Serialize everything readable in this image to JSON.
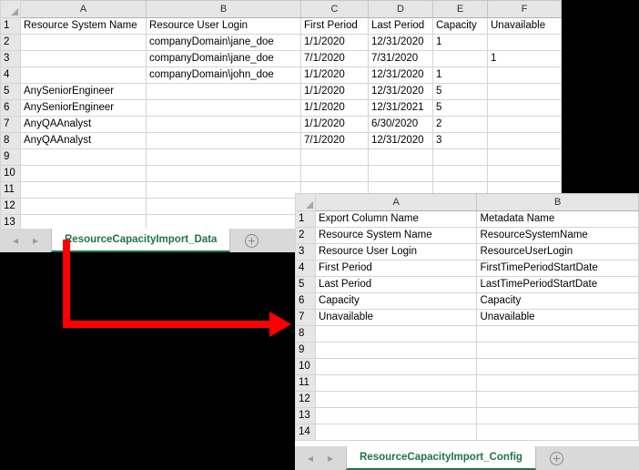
{
  "theme": {
    "accent_green": "#217346",
    "arrow_color": "#FF0000",
    "header_gray": "#E6E6E6",
    "grid_line": "#D4D4D4",
    "backdrop": "#000000"
  },
  "data_sheet": {
    "tab_label": "ResourceCapacityImport_Data",
    "nav_prev_icon": "left-arrow-icon",
    "nav_next_icon": "right-arrow-icon",
    "add_sheet_icon": "plus-circle-icon",
    "corner_icon": "select-all-triangle-icon",
    "column_letters": [
      "A",
      "B",
      "C",
      "D",
      "E",
      "F"
    ],
    "row_numbers": [
      "1",
      "2",
      "3",
      "4",
      "5",
      "6",
      "7",
      "8",
      "9",
      "10",
      "11",
      "12",
      "13",
      "14"
    ],
    "headers": [
      "Resource System Name",
      "Resource User Login",
      "First Period",
      "Last Period",
      "Capacity",
      "Unavailable"
    ],
    "rows": [
      [
        "",
        "companyDomain\\jane_doe",
        "1/1/2020",
        "12/31/2020",
        "1",
        ""
      ],
      [
        "",
        "companyDomain\\jane_doe",
        "7/1/2020",
        "7/31/2020",
        "",
        "1"
      ],
      [
        "",
        "companyDomain\\john_doe",
        "1/1/2020",
        "12/31/2020",
        "1",
        ""
      ],
      [
        "AnySeniorEngineer",
        "",
        "1/1/2020",
        "12/31/2020",
        "5",
        ""
      ],
      [
        "AnySeniorEngineer",
        "",
        "1/1/2020",
        "12/31/2021",
        "5",
        ""
      ],
      [
        "AnyQAAnalyst",
        "",
        "1/1/2020",
        "6/30/2020",
        "2",
        ""
      ],
      [
        "AnyQAAnalyst",
        "",
        "7/1/2020",
        "12/31/2020",
        "3",
        ""
      ],
      [
        "",
        "",
        "",
        "",
        "",
        ""
      ],
      [
        "",
        "",
        "",
        "",
        "",
        ""
      ],
      [
        "",
        "",
        "",
        "",
        "",
        ""
      ],
      [
        "",
        "",
        "",
        "",
        "",
        ""
      ],
      [
        "",
        "",
        "",
        "",
        "",
        ""
      ],
      [
        "",
        "",
        "",
        "",
        "",
        ""
      ]
    ]
  },
  "config_sheet": {
    "tab_label": "ResourceCapacityImport_Config",
    "nav_prev_icon": "left-arrow-icon",
    "nav_next_icon": "right-arrow-icon",
    "add_sheet_icon": "plus-circle-icon",
    "corner_icon": "select-all-triangle-icon",
    "column_letters": [
      "A",
      "B"
    ],
    "row_numbers": [
      "1",
      "2",
      "3",
      "4",
      "5",
      "6",
      "7",
      "8",
      "9",
      "10",
      "11",
      "12",
      "13",
      "14"
    ],
    "headers": [
      "Export Column Name",
      "Metadata Name"
    ],
    "rows": [
      [
        "Resource System Name",
        "ResourceSystemName"
      ],
      [
        "Resource User Login",
        "ResourceUserLogin"
      ],
      [
        "First Period",
        "FirstTimePeriodStartDate"
      ],
      [
        "Last Period",
        "LastTimePeriodStartDate"
      ],
      [
        "Capacity",
        "Capacity"
      ],
      [
        "Unavailable",
        "Unavailable"
      ],
      [
        "",
        ""
      ],
      [
        "",
        ""
      ],
      [
        "",
        ""
      ],
      [
        "",
        ""
      ],
      [
        "",
        ""
      ],
      [
        "",
        ""
      ],
      [
        "",
        ""
      ]
    ]
  },
  "annotation": {
    "arrow_icon": "red-elbow-arrow-icon"
  }
}
